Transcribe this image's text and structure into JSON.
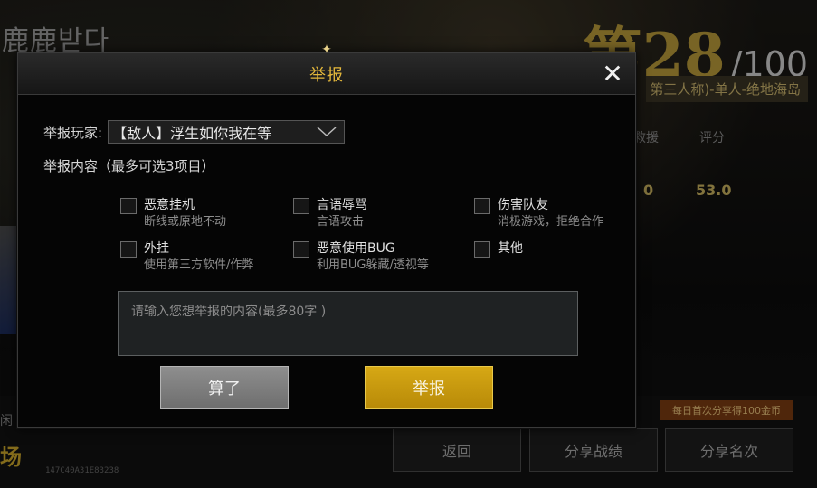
{
  "background": {
    "player_name": "鹿鹿받다",
    "rank": "第28",
    "rank_total": "/100",
    "mode": "第三人称)-单人-绝地海岛",
    "stats_headers": [
      "救援",
      "评分"
    ],
    "stats_values": [
      "0",
      "53.0"
    ],
    "idle_label": "闲",
    "logo_text": "场",
    "session_code": "147C40A31E83238",
    "promo": "每日首次分享得100金币",
    "buttons": {
      "back": "返回",
      "share_record": "分享战绩",
      "share_name": "分享名次"
    }
  },
  "dialog": {
    "title": "举报",
    "close_icon": "close-icon",
    "player_label": "举报玩家:",
    "player_selected": "【敌人】浮生如你我在等",
    "content_label": "举报内容（最多可选3项目）",
    "options": [
      {
        "title": "恶意挂机",
        "subtitle": "断线或原地不动",
        "checked": false
      },
      {
        "title": "言语辱骂",
        "subtitle": "言语攻击",
        "checked": false
      },
      {
        "title": "伤害队友",
        "subtitle": "消极游戏，拒绝合作",
        "checked": false
      },
      {
        "title": "外挂",
        "subtitle": "使用第三方软件/作弊",
        "checked": false
      },
      {
        "title": "恶意使用BUG",
        "subtitle": "利用BUG躲藏/透视等",
        "checked": false
      },
      {
        "title": "其他",
        "subtitle": "",
        "checked": false
      }
    ],
    "textarea_placeholder": "请输入您想举报的内容(最多80字 )",
    "cancel_label": "算了",
    "submit_label": "举报"
  },
  "colors": {
    "accent_gold": "#e3b73b",
    "submit_button": "#c99a0e",
    "cancel_button": "#7e7e7e"
  }
}
